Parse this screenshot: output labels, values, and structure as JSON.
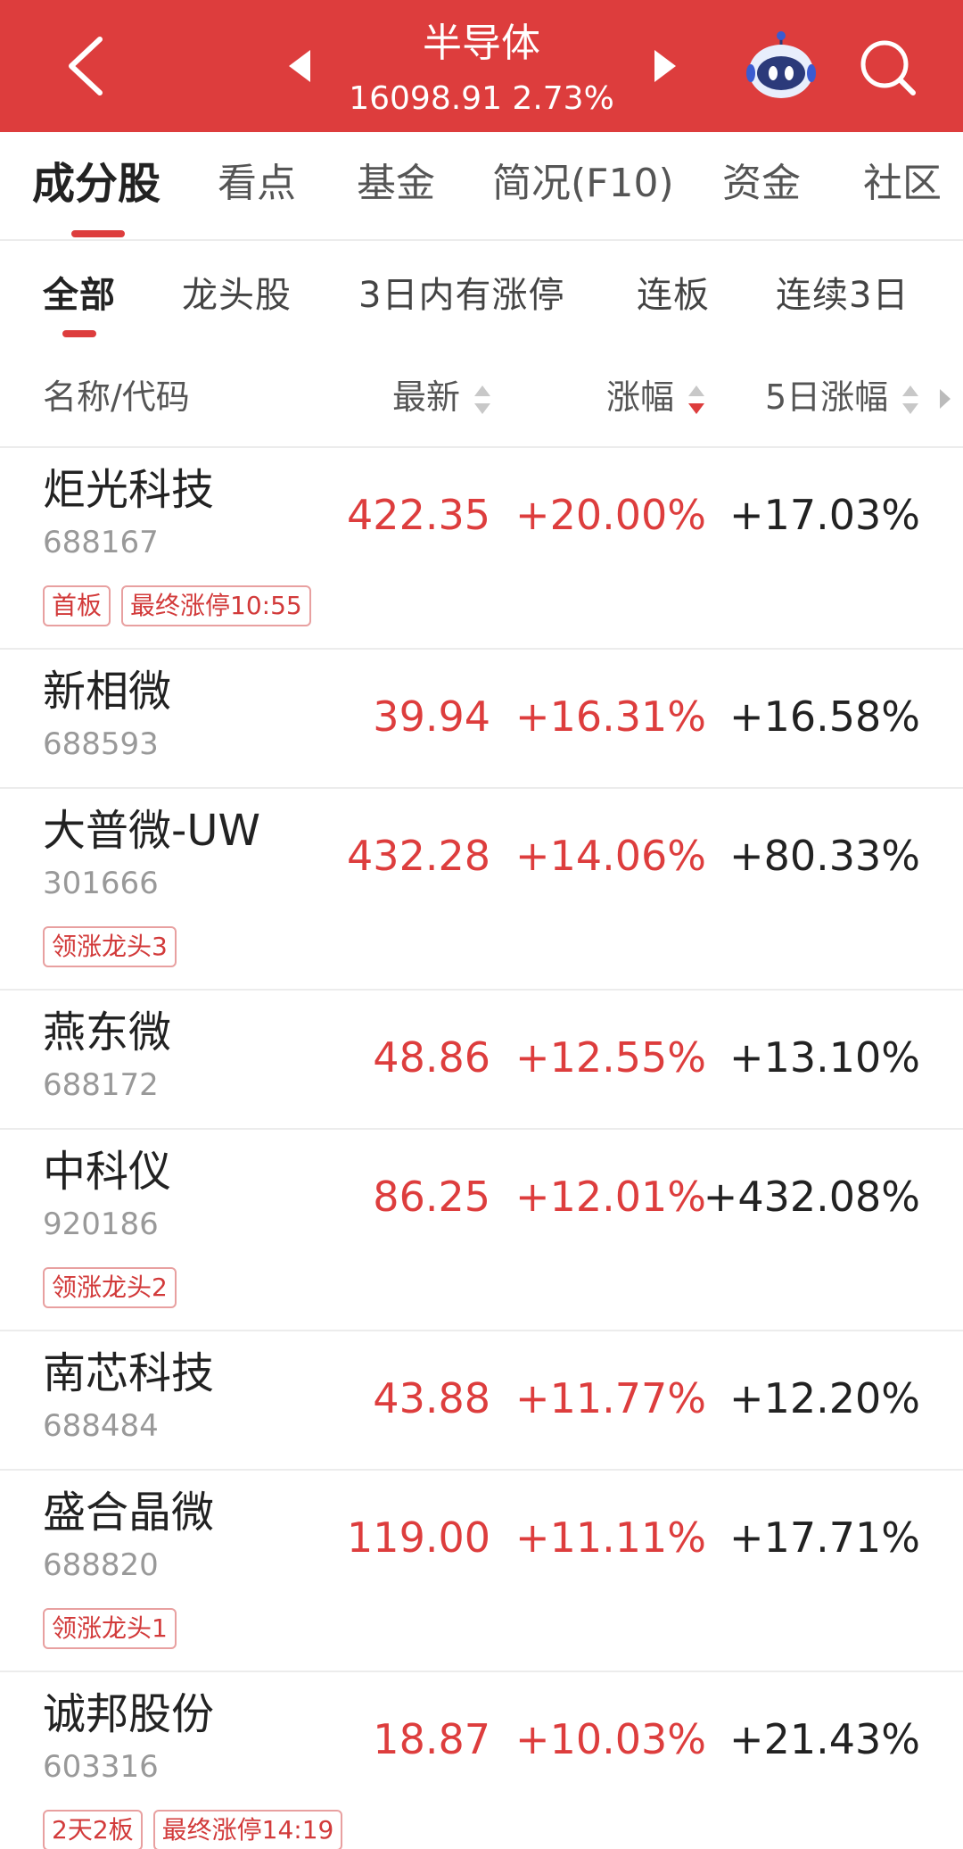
{
  "header": {
    "title": "半导体",
    "quote": "16098.91 2.73%",
    "bg_color": "#dd3d3d"
  },
  "main_tabs": [
    {
      "label": "成分股",
      "active": true
    },
    {
      "label": "看点"
    },
    {
      "label": "基金"
    },
    {
      "label": "简况(F10)"
    },
    {
      "label": "资金"
    },
    {
      "label": "社区"
    }
  ],
  "sub_tabs": [
    {
      "label": "全部",
      "active": true
    },
    {
      "label": "龙头股"
    },
    {
      "label": "3日内有涨停"
    },
    {
      "label": "连板"
    },
    {
      "label": "连续3日"
    }
  ],
  "columns": {
    "name": "名称/代码",
    "latest": "最新",
    "change": "涨幅",
    "five_day": "5日涨幅"
  },
  "rows": [
    {
      "name": "炬光科技",
      "code": "688167",
      "price": "422.35",
      "change": "+20.00%",
      "five_day": "+17.03%",
      "tags": [
        "首板",
        "最终涨停10:55"
      ]
    },
    {
      "name": "新相微",
      "code": "688593",
      "price": "39.94",
      "change": "+16.31%",
      "five_day": "+16.58%",
      "tags": []
    },
    {
      "name": "大普微-UW",
      "code": "301666",
      "price": "432.28",
      "change": "+14.06%",
      "five_day": "+80.33%",
      "tags": [
        "领涨龙头3"
      ]
    },
    {
      "name": "燕东微",
      "code": "688172",
      "price": "48.86",
      "change": "+12.55%",
      "five_day": "+13.10%",
      "tags": []
    },
    {
      "name": "中科仪",
      "code": "920186",
      "price": "86.25",
      "change": "+12.01%",
      "five_day": "+432.08%",
      "tags": [
        "领涨龙头2"
      ]
    },
    {
      "name": "南芯科技",
      "code": "688484",
      "price": "43.88",
      "change": "+11.77%",
      "five_day": "+12.20%",
      "tags": []
    },
    {
      "name": "盛合晶微",
      "code": "688820",
      "price": "119.00",
      "change": "+11.11%",
      "five_day": "+17.71%",
      "tags": [
        "领涨龙头1"
      ]
    },
    {
      "name": "诚邦股份",
      "code": "603316",
      "price": "18.87",
      "change": "+10.03%",
      "five_day": "+21.43%",
      "tags": [
        "2天2板",
        "最终涨停14:19"
      ]
    }
  ]
}
